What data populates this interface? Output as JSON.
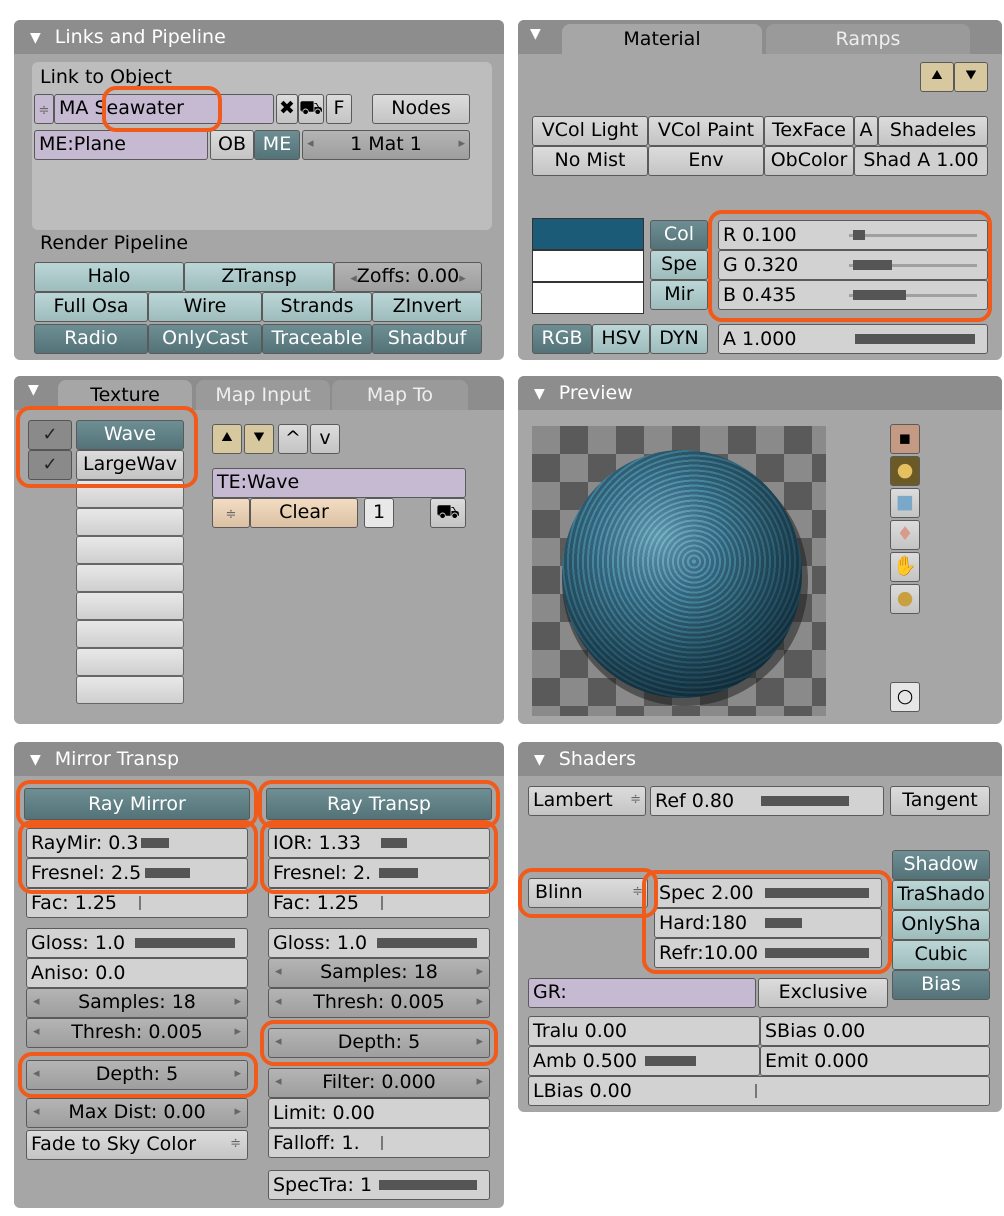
{
  "colors": {
    "accent_oval": "#f05a1a",
    "panel": "#a6a6a6",
    "header": "#8d8d8d",
    "teal": "#9dbcbc",
    "teal_dark": "#537378",
    "col_swatch": "#1b5b78"
  },
  "links": {
    "title": "Links and Pipeline",
    "link_to_object": "Link to Object",
    "ma_prefix": "MA",
    "material_name": "Seawater",
    "x_icon": "x-icon",
    "fake_user_icon": "car-icon",
    "f_label": "F",
    "nodes_label": "Nodes",
    "mesh_name": "ME:Plane",
    "ob_label": "OB",
    "me_label": "ME",
    "mat_index": "1 Mat 1",
    "render_pipeline": "Render Pipeline",
    "pipeline_buttons": {
      "halo": "Halo",
      "ztransp": "ZTransp",
      "zoffs": "Zoffs: 0.00",
      "full_osa": "Full Osa",
      "wire": "Wire",
      "strands": "Strands",
      "zinvert": "ZInvert",
      "radio": "Radio",
      "onlycast": "OnlyCast",
      "traceable": "Traceable",
      "shadbuf": "Shadbuf"
    }
  },
  "material": {
    "tabs": [
      "Material",
      "Ramps"
    ],
    "row1": [
      "VCol Light",
      "VCol Paint",
      "TexFace",
      "A",
      "Shadeles"
    ],
    "row2": [
      "No Mist",
      "Env",
      "ObColor",
      "Shad A 1.00"
    ],
    "color_buttons": [
      "Col",
      "Spe",
      "Mir"
    ],
    "r": "R 0.100",
    "g": "G 0.320",
    "b": "B 0.435",
    "r_value": 0.1,
    "g_value": 0.32,
    "b_value": 0.435,
    "modes": [
      "RGB",
      "HSV",
      "DYN"
    ],
    "alpha": "A 1.000",
    "alpha_value": 1.0
  },
  "texture": {
    "tabs": [
      "Texture",
      "Map Input",
      "Map To"
    ],
    "slots": [
      "Wave",
      "LargeWav"
    ],
    "te_name": "TE:Wave",
    "clear_label": "Clear",
    "users": "1"
  },
  "preview": {
    "title": "Preview"
  },
  "mirror": {
    "title": "Mirror Transp",
    "ray_mirror": "Ray Mirror",
    "ray_transp": "Ray Transp",
    "left": {
      "raymir": "RayMir: 0.3",
      "raymir_value": 0.3,
      "fresnel": "Fresnel: 2.5",
      "fresnel_value": 2.5,
      "fac": "Fac: 1.25",
      "fac_value": 1.25,
      "gloss": "Gloss: 1.0",
      "gloss_value": 1.0,
      "aniso": "Aniso: 0.0",
      "aniso_value": 0.0,
      "samples": "Samples: 18",
      "thresh": "Thresh: 0.005",
      "depth": "Depth: 5",
      "maxdist": "Max Dist: 0.00",
      "fade": "Fade to Sky Color"
    },
    "right": {
      "ior": "IOR: 1.33",
      "ior_value": 1.33,
      "fresnel": "Fresnel: 2.",
      "fresnel_value": 2.0,
      "fac": "Fac: 1.25",
      "fac_value": 1.25,
      "gloss": "Gloss: 1.0",
      "gloss_value": 1.0,
      "samples": "Samples: 18",
      "thresh": "Thresh: 0.005",
      "depth": "Depth: 5",
      "filter": "Filter: 0.000",
      "limit": "Limit: 0.00",
      "falloff": "Falloff: 1.",
      "spectra": "SpecTra: 1",
      "spectra_value": 1.0
    }
  },
  "shaders": {
    "title": "Shaders",
    "diffuse": "Lambert",
    "ref": "Ref  0.80",
    "ref_value": 0.8,
    "tangent": "Tangent",
    "spec_shader": "Blinn",
    "spec": "Spec 2.00",
    "spec_value": 2.0,
    "hard": "Hard:180",
    "hard_value": 180,
    "refr": "Refr:10.00",
    "refr_value": 10.0,
    "shadow_buttons": [
      "Shadow",
      "TraShado",
      "OnlySha",
      "Cubic",
      "Bias"
    ],
    "group": "GR:",
    "exclusive": "Exclusive",
    "tralu": "Tralu 0.00",
    "sbias": "SBias 0.00",
    "amb": "Amb 0.500",
    "amb_value": 0.5,
    "emit": "Emit 0.000",
    "lbias": "LBias 0.00"
  }
}
